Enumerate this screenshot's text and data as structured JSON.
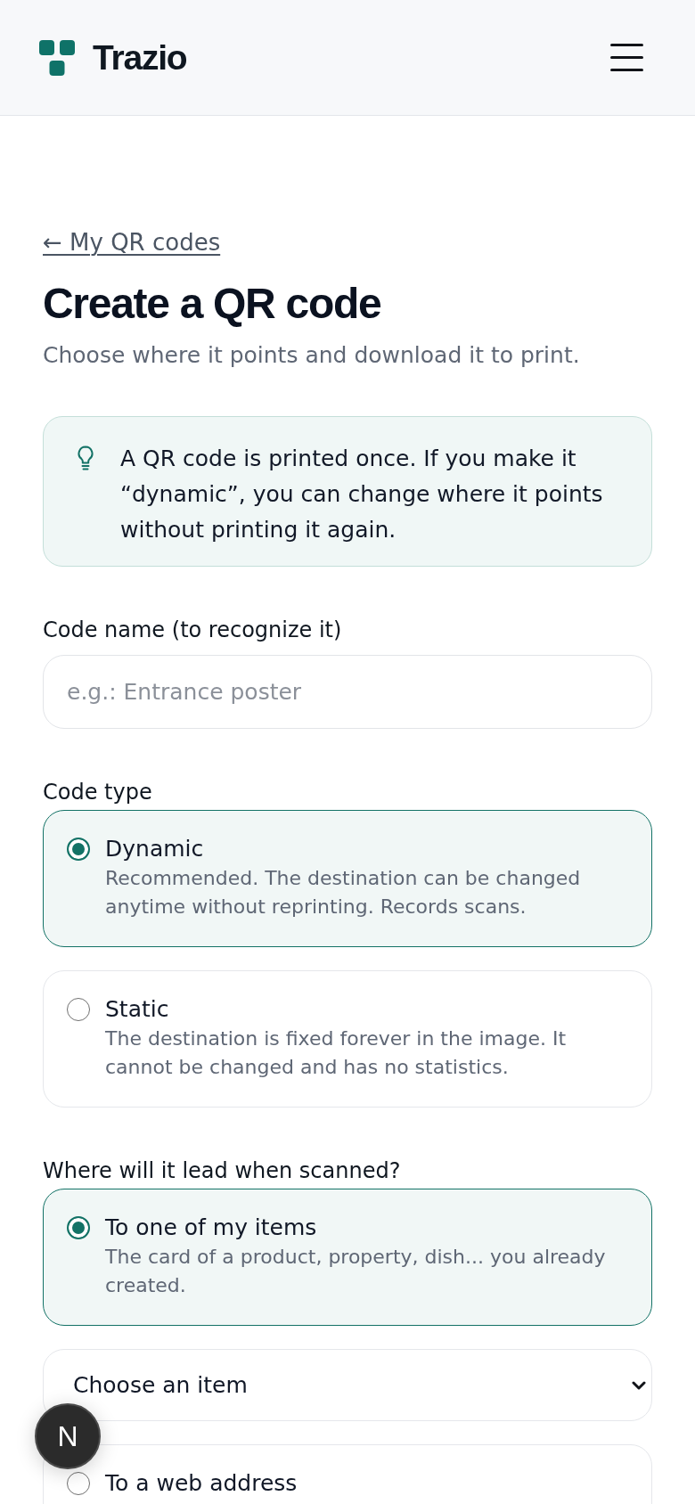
{
  "header": {
    "brand": "Trazio"
  },
  "back_link": "← My QR codes",
  "title": "Create a QR code",
  "subtitle": "Choose where it points and download it to print.",
  "info": {
    "text": "A QR code is printed once. If you make it “dynamic”, you can change where it points without printing it again."
  },
  "name_field": {
    "label": "Code name (to recognize it)",
    "placeholder": "e.g.: Entrance poster"
  },
  "code_type": {
    "label": "Code type",
    "options": [
      {
        "title": "Dynamic",
        "description": "Recommended. The destination can be changed anytime without reprinting. Records scans.",
        "selected": true
      },
      {
        "title": "Static",
        "description": "The destination is fixed forever in the image. It cannot be changed and has no statistics.",
        "selected": false
      }
    ]
  },
  "destination": {
    "label": "Where will it lead when scanned?",
    "options": [
      {
        "title": "To one of my items",
        "description": "The card of a product, property, dish... you already created.",
        "selected": true,
        "select": {
          "value": "Choose an item"
        }
      },
      {
        "title": "To a web address",
        "selected": false
      }
    ]
  },
  "dev_badge": {
    "label": "N"
  }
}
